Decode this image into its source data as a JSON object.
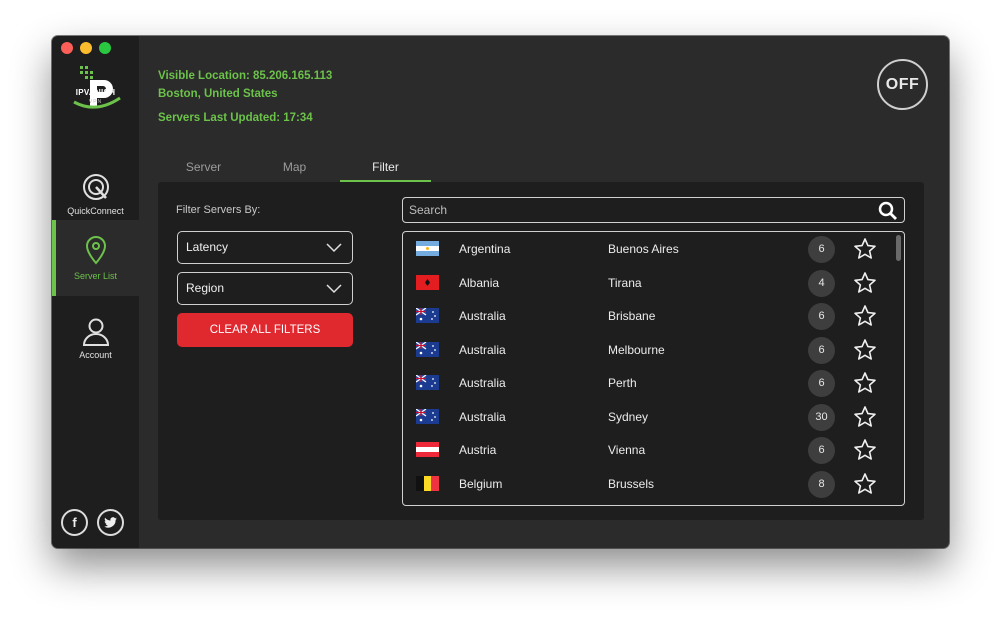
{
  "app": {
    "logo_text": "IPVANISH",
    "logo_sub": "VPN"
  },
  "sidebar": {
    "items": [
      {
        "label": "QuickConnect",
        "icon": "quickconnect-icon",
        "active": false
      },
      {
        "label": "Server List",
        "icon": "location-pin-icon",
        "active": true
      },
      {
        "label": "Account",
        "icon": "user-icon",
        "active": false
      }
    ],
    "social": [
      {
        "icon": "facebook-icon",
        "glyph": "f"
      },
      {
        "icon": "twitter-icon",
        "glyph": "t"
      }
    ]
  },
  "status": {
    "visible_location": "Visible Location: 85.206.165.113",
    "city": "Boston, United States",
    "servers_updated": "Servers Last Updated: 17:34"
  },
  "connect_button": {
    "label": "OFF"
  },
  "tabs": [
    {
      "label": "Server",
      "active": false
    },
    {
      "label": "Map",
      "active": false
    },
    {
      "label": "Filter",
      "active": true
    }
  ],
  "filters": {
    "heading": "Filter Servers By:",
    "latency": "Latency",
    "region": "Region",
    "clear_label": "CLEAR ALL FILTERS"
  },
  "search": {
    "placeholder": "Search"
  },
  "servers": [
    {
      "country": "Argentina",
      "city": "Buenos Aires",
      "count": "6",
      "flag": "argentina-flag"
    },
    {
      "country": "Albania",
      "city": "Tirana",
      "count": "4",
      "flag": "albania-flag"
    },
    {
      "country": "Australia",
      "city": "Brisbane",
      "count": "6",
      "flag": "australia-flag"
    },
    {
      "country": "Australia",
      "city": "Melbourne",
      "count": "6",
      "flag": "australia-flag"
    },
    {
      "country": "Australia",
      "city": "Perth",
      "count": "6",
      "flag": "australia-flag"
    },
    {
      "country": "Australia",
      "city": "Sydney",
      "count": "30",
      "flag": "australia-flag"
    },
    {
      "country": "Austria",
      "city": "Vienna",
      "count": "6",
      "flag": "austria-flag"
    },
    {
      "country": "Belgium",
      "city": "Brussels",
      "count": "8",
      "flag": "belgium-flag"
    }
  ],
  "colors": {
    "accent": "#6cc24a",
    "danger": "#e0282f",
    "background": "#2b2b2b",
    "panel": "#1e1e1e"
  }
}
